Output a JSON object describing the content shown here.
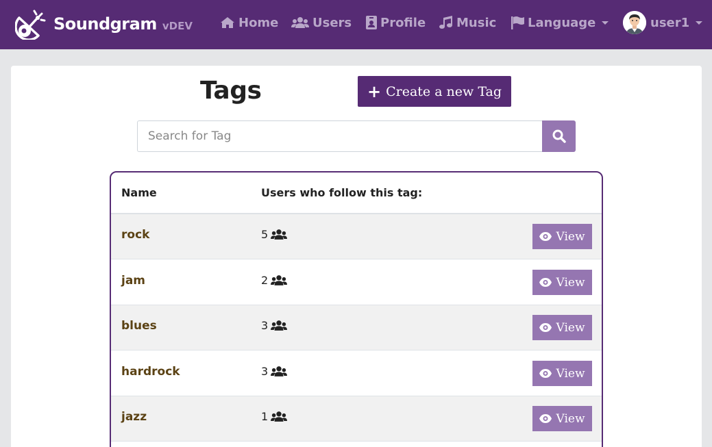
{
  "navbar": {
    "brand_name": "Soundgram",
    "brand_version": "vDEV",
    "brand_logo_icon": "satellite-dish-icon",
    "items": [
      {
        "label": "Home",
        "icon": "home-icon"
      },
      {
        "label": "Users",
        "icon": "users-icon"
      },
      {
        "label": "Profile",
        "icon": "id-badge-icon"
      },
      {
        "label": "Music",
        "icon": "music-icon"
      },
      {
        "label": "Language",
        "icon": "flag-icon"
      }
    ],
    "user": {
      "name": "user1"
    }
  },
  "page": {
    "title": "Tags",
    "create_button": "Create a new Tag"
  },
  "search": {
    "placeholder": "Search for Tag",
    "value": ""
  },
  "table": {
    "headers": [
      "Name",
      "Users who follow this tag:"
    ],
    "rows": [
      {
        "name": "rock",
        "followers": "5",
        "action": "View"
      },
      {
        "name": "jam",
        "followers": "2",
        "action": "View"
      },
      {
        "name": "blues",
        "followers": "3",
        "action": "View"
      },
      {
        "name": "hardrock",
        "followers": "3",
        "action": "View"
      },
      {
        "name": "jazz",
        "followers": "1",
        "action": "View"
      }
    ]
  },
  "colors": {
    "primary": "#562b74",
    "accent": "#9576b1",
    "nav_text": "#b9a7c9",
    "tag_text": "#5b4214",
    "background": "#e5e6e8"
  }
}
